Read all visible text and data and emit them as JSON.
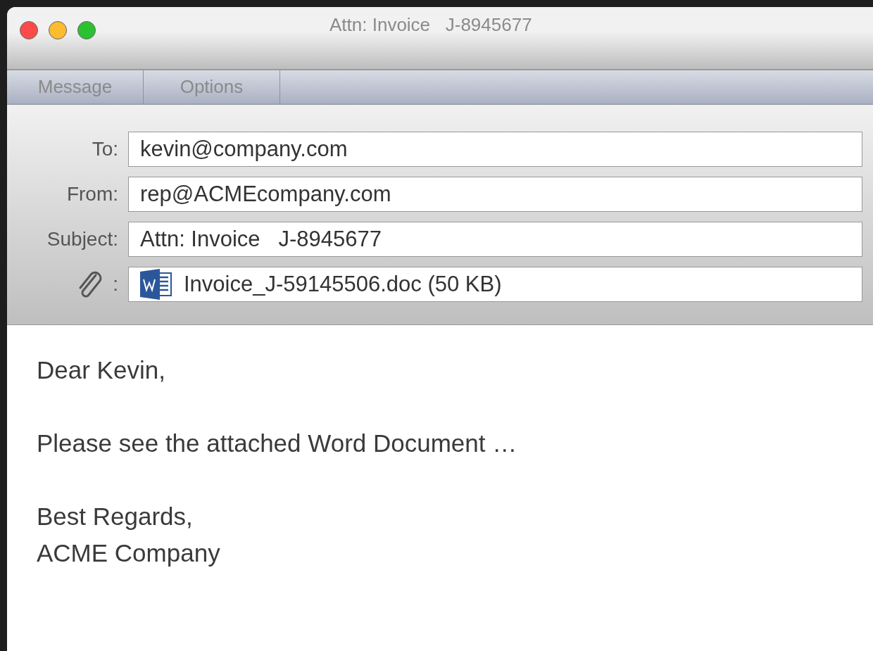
{
  "window": {
    "title": "Attn: Invoice   J-8945677"
  },
  "tabs": [
    {
      "label": "Message"
    },
    {
      "label": "Options"
    }
  ],
  "header_fields": [
    {
      "kind": "text",
      "label": "To:",
      "value": "kevin@company.com"
    },
    {
      "kind": "text",
      "label": "From:",
      "value": "rep@ACMEcompany.com"
    },
    {
      "kind": "text",
      "label": "Subject:",
      "value": "Attn: Invoice   J-8945677"
    },
    {
      "kind": "attachment",
      "label": ":",
      "value": "Invoice_J-59145506.doc (50 KB)"
    }
  ],
  "body": [
    {
      "lines": [
        "Dear Kevin,"
      ]
    },
    {
      "lines": [
        "Please see the attached Word Document …"
      ]
    },
    {
      "lines": [
        "Best Regards,",
        "ACME Company"
      ]
    }
  ]
}
